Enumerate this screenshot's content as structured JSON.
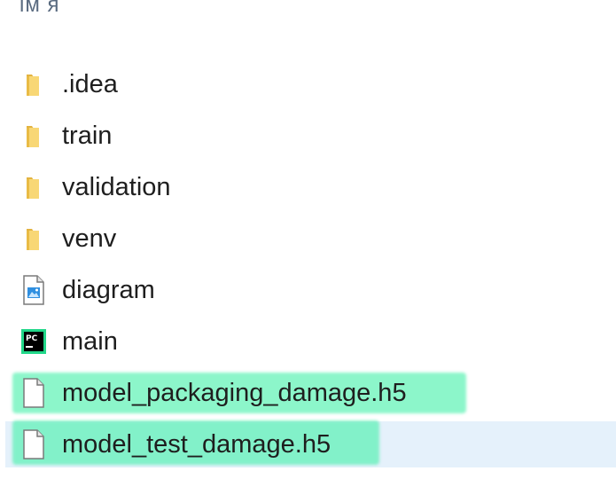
{
  "header": {
    "label": "ім я"
  },
  "files": [
    {
      "name": ".idea",
      "icon": "folder-icon"
    },
    {
      "name": "train",
      "icon": "folder-icon"
    },
    {
      "name": "validation",
      "icon": "folder-icon"
    },
    {
      "name": "venv",
      "icon": "folder-icon"
    },
    {
      "name": "diagram",
      "icon": "image-file-icon"
    },
    {
      "name": "main",
      "icon": "pycharm-icon"
    },
    {
      "name": "model_packaging_damage.h5",
      "icon": "blank-file-icon"
    },
    {
      "name": "model_test_damage.h5",
      "icon": "blank-file-icon",
      "selected": true
    }
  ],
  "colors": {
    "folder": "#f8d775",
    "selection": "#e5f1fb",
    "marker_highlight": "#46f0aa"
  }
}
